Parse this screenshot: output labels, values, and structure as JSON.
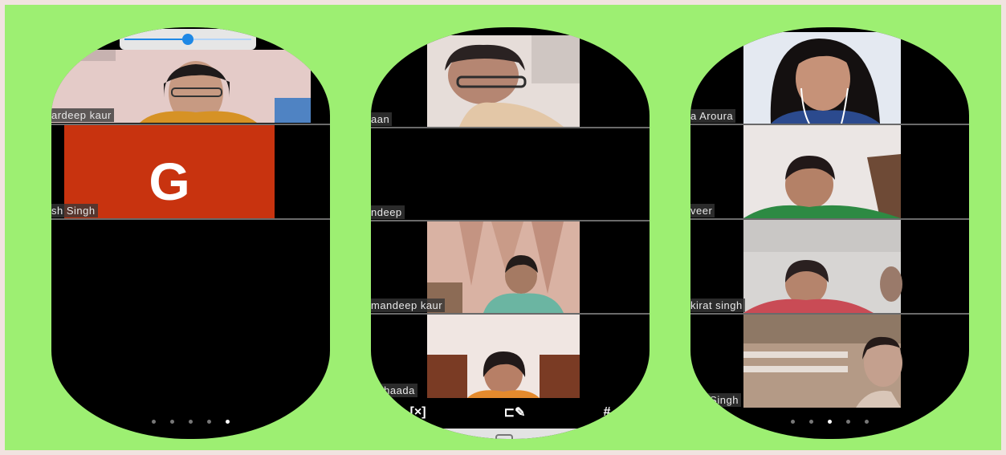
{
  "slider": {
    "level": 0.5
  },
  "phones": [
    {
      "participants": [
        {
          "name": "ardeep kaur"
        },
        {
          "name": "sh Singh",
          "initial": "G"
        }
      ],
      "pager": {
        "count": 5,
        "active_index": 4
      }
    },
    {
      "participants": [
        {
          "name": "aan"
        },
        {
          "name": "ndeep"
        },
        {
          "name": "mandeep kaur"
        },
        {
          "name": "Achaada"
        }
      ],
      "toolbar": [
        {
          "icon": "screen-share-icon",
          "glyph": "[×]"
        },
        {
          "icon": "annotate-icon",
          "glyph": "⊏✎"
        },
        {
          "icon": "hash-icon",
          "glyph": "#"
        }
      ]
    },
    {
      "participants": [
        {
          "name": "a Aroura"
        },
        {
          "name": "veer"
        },
        {
          "name": "kirat singh"
        },
        {
          "name": "irat Singh"
        }
      ],
      "pager": {
        "count": 5,
        "active_index": 2
      }
    }
  ],
  "colors": {
    "background": "#9def72",
    "avatar_tile": "#c8330f",
    "slider_accent": "#1e88e5"
  }
}
